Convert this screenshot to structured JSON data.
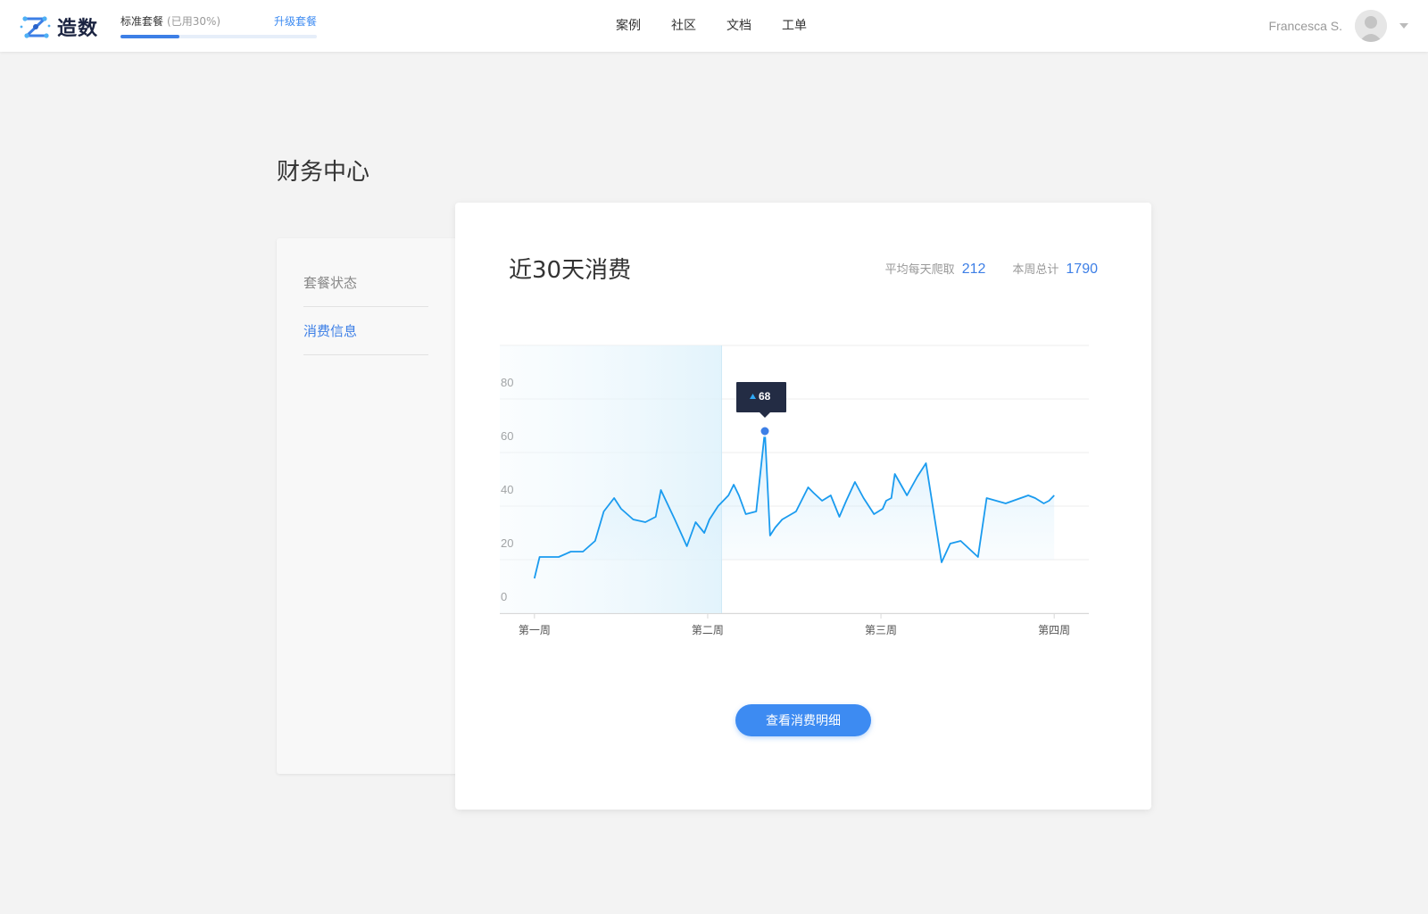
{
  "header": {
    "logo_text": "造数",
    "plan": {
      "name": "标准套餐",
      "usage": "(已用30%)",
      "usage_percent": 30,
      "upgrade_label": "升级套餐"
    },
    "nav": [
      {
        "label": "案例"
      },
      {
        "label": "社区"
      },
      {
        "label": "文档"
      },
      {
        "label": "工单"
      }
    ],
    "user": {
      "name": "Francesca S."
    }
  },
  "page": {
    "title": "财务中心",
    "sidebar": [
      {
        "label": "套餐状态",
        "active": false
      },
      {
        "label": "消费信息",
        "active": true
      }
    ]
  },
  "card": {
    "title": "近30天消费",
    "stats": [
      {
        "label": "平均每天爬取",
        "value": "212"
      },
      {
        "label": "本周总计",
        "value": "1790"
      }
    ],
    "button_label": "查看消费明细"
  },
  "colors": {
    "accent": "#3d7fe6",
    "line": "#1a9bef",
    "highlight_band": "#e3f3fb",
    "tooltip_bg": "#232c44"
  },
  "chart_data": {
    "type": "area",
    "ylim": [
      0,
      100
    ],
    "y_ticks": [
      0,
      20,
      40,
      60,
      80
    ],
    "x_ticks": [
      {
        "label": "第一周",
        "x": 0
      },
      {
        "label": "第二周",
        "x": 10
      },
      {
        "label": "第三周",
        "x": 20
      },
      {
        "label": "第四周",
        "x": 30
      }
    ],
    "x_range": [
      -2,
      32
    ],
    "highlight_range": [
      -2,
      10.8
    ],
    "x": [
      0,
      0.3,
      1.4,
      2.1,
      2.8,
      3.5,
      4.0,
      4.6,
      5.0,
      5.7,
      6.4,
      7.0,
      7.3,
      8.1,
      8.8,
      9.3,
      9.8,
      10.1,
      10.6,
      10.9,
      11.2,
      11.5,
      11.8,
      12.2,
      12.8,
      13.3,
      13.6,
      13.9,
      14.3,
      15.1,
      15.8,
      16.1,
      16.6,
      17.1,
      17.6,
      18.0,
      18.5,
      19.0,
      19.6,
      20.1,
      20.3,
      20.6,
      20.8,
      21.5,
      22.1,
      22.6,
      23.5,
      24.0,
      24.6,
      25.6,
      26.1,
      27.2,
      28.5,
      28.9,
      29.4,
      29.7,
      30.0
    ],
    "y": [
      13,
      21,
      21,
      23,
      23,
      27,
      38,
      43,
      39,
      35,
      34,
      36,
      46,
      35,
      25,
      34,
      30,
      35,
      40,
      42,
      44,
      48,
      44,
      37,
      38,
      68,
      29,
      32,
      35,
      38,
      47,
      45,
      42,
      44,
      36,
      42,
      49,
      43,
      37,
      39,
      42,
      43,
      52,
      44,
      51,
      56,
      19,
      26,
      27,
      21,
      43,
      41,
      44,
      43,
      41,
      42,
      44
    ],
    "highlight_point": {
      "x": 13.3,
      "y": 68,
      "label": "68"
    }
  }
}
